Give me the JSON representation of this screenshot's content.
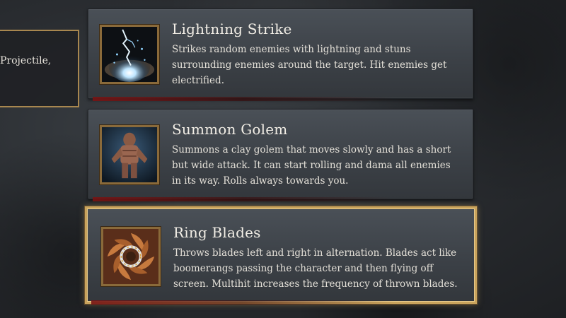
{
  "side_panel": {
    "fragment_text": "Projectile,"
  },
  "skills": [
    {
      "name": "Lightning Strike",
      "description": "Strikes random enemies with lightning and stuns surrounding enemies around the target. Hit enemies get electrified.",
      "icon": "lightning-icon"
    },
    {
      "name": "Summon Golem",
      "description": "Summons a clay golem that moves slowly and has a short but wide attack. It can start rolling and dama all enemies in its way. Rolls always towards you.",
      "icon": "golem-icon"
    },
    {
      "name": "Ring Blades",
      "description": "Throws blades left and right in alternation. Blades act like boomerangs passing the character and then flying off screen. Multihit increases the frequency of thrown blades.",
      "icon": "ring-blades-icon"
    }
  ],
  "colors": {
    "frame_gold": "#c9a35c",
    "card_bg": "#41464c",
    "text": "#e8e4dc"
  }
}
